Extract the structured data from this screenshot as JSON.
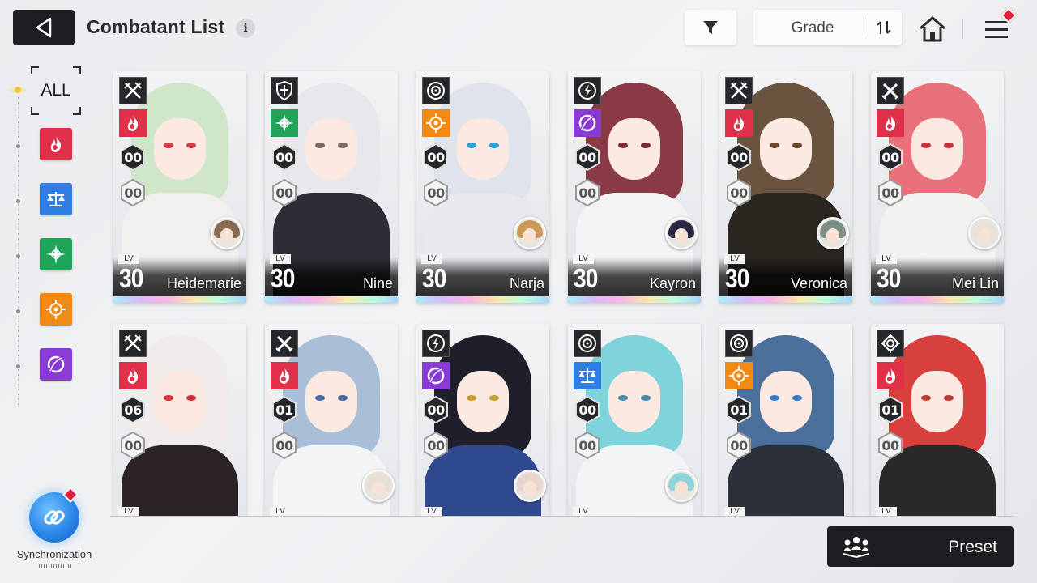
{
  "header": {
    "title": "Combatant List",
    "info_glyph": "i",
    "sort_label": "Grade"
  },
  "sidebar": {
    "all_label": "ALL",
    "elements": [
      {
        "name": "flame",
        "color": "#e0304a"
      },
      {
        "name": "scales",
        "color": "#2f7ee0"
      },
      {
        "name": "compass-star",
        "color": "#21a35a"
      },
      {
        "name": "sun",
        "color": "#f08a14"
      },
      {
        "name": "void-swirl",
        "color": "#8a3bd6"
      }
    ],
    "sync_label": "Synchronization"
  },
  "combatants": [
    {
      "name": "Heidemarie",
      "level": "30",
      "class": "crossed-swords",
      "element": "flame",
      "rank": "00",
      "sub": "00",
      "hair": "#cfe6c9",
      "body": "#f2f0ee",
      "eye": "#d23c4a",
      "has_avatar": true,
      "avatar_hair": "#8a6b52"
    },
    {
      "name": "Nine",
      "level": "30",
      "class": "shield",
      "element": "compass-star",
      "rank": "00",
      "sub": "00",
      "hair": "#e8e8ec",
      "body": "#2d2e35",
      "eye": "#7a6a60",
      "has_avatar": false,
      "avatar_hair": ""
    },
    {
      "name": "Narja",
      "level": "30",
      "class": "target",
      "element": "sun",
      "rank": "00",
      "sub": "00",
      "hair": "#dfe3ec",
      "body": "#e8e8ee",
      "eye": "#2a9fd8",
      "has_avatar": true,
      "avatar_hair": "#c99a58"
    },
    {
      "name": "Kayron",
      "level": "30",
      "class": "lightning",
      "element": "void-swirl",
      "rank": "00",
      "sub": "00",
      "hair": "#8a3a44",
      "body": "#f3f3f5",
      "eye": "#7a2a30",
      "has_avatar": true,
      "avatar_hair": "#2a2740"
    },
    {
      "name": "Veronica",
      "level": "30",
      "class": "crossed-swords",
      "element": "flame",
      "rank": "00",
      "sub": "00",
      "hair": "#6a5440",
      "body": "#2a2620",
      "eye": "#6b4a2c",
      "has_avatar": true,
      "avatar_hair": "#7b8f86"
    },
    {
      "name": "Mei Lin",
      "level": "30",
      "class": "crossed-blades",
      "element": "flame",
      "rank": "00",
      "sub": "00",
      "hair": "#e8707a",
      "body": "#f4f2f1",
      "eye": "#c8303c",
      "has_avatar": true,
      "avatar_hair": "#e7e3da"
    },
    {
      "name": "",
      "level": "",
      "class": "crossed-swords",
      "element": "flame",
      "rank": "06",
      "sub": "00",
      "hair": "#f0ecec",
      "body": "#2a2224",
      "eye": "#d23040",
      "has_avatar": false,
      "avatar_hair": ""
    },
    {
      "name": "",
      "level": "",
      "class": "crossed-blades",
      "element": "flame",
      "rank": "01",
      "sub": "00",
      "hair": "#a9bfd8",
      "body": "#f3f4f6",
      "eye": "#4a6aa0",
      "has_avatar": true,
      "avatar_hair": "#e6e0d4"
    },
    {
      "name": "",
      "level": "",
      "class": "lightning",
      "element": "void-swirl",
      "rank": "00",
      "sub": "00",
      "hair": "#1e1f2a",
      "body": "#2f4a8f",
      "eye": "#c8a030",
      "has_avatar": true,
      "avatar_hair": "#e8d6cc"
    },
    {
      "name": "",
      "level": "",
      "class": "target",
      "element": "scales",
      "rank": "00",
      "sub": "00",
      "hair": "#7fd4dc",
      "body": "#f3f4f6",
      "eye": "#4a8aa8",
      "has_avatar": true,
      "avatar_hair": "#8fd4dc"
    },
    {
      "name": "",
      "level": "",
      "class": "target",
      "element": "sun",
      "rank": "01",
      "sub": "00",
      "hair": "#4a6f9a",
      "body": "#2a2f3a",
      "eye": "#3a78c8",
      "has_avatar": false,
      "avatar_hair": ""
    },
    {
      "name": "",
      "level": "",
      "class": "diamond-target",
      "element": "flame",
      "rank": "01",
      "sub": "00",
      "hair": "#d8403e",
      "body": "#2a2828",
      "eye": "#b83a30",
      "has_avatar": false,
      "avatar_hair": ""
    }
  ],
  "footer": {
    "preset_label": "Preset"
  },
  "colors": {
    "dark_button": "#1d1e22",
    "badge_red": "#e0203a"
  }
}
